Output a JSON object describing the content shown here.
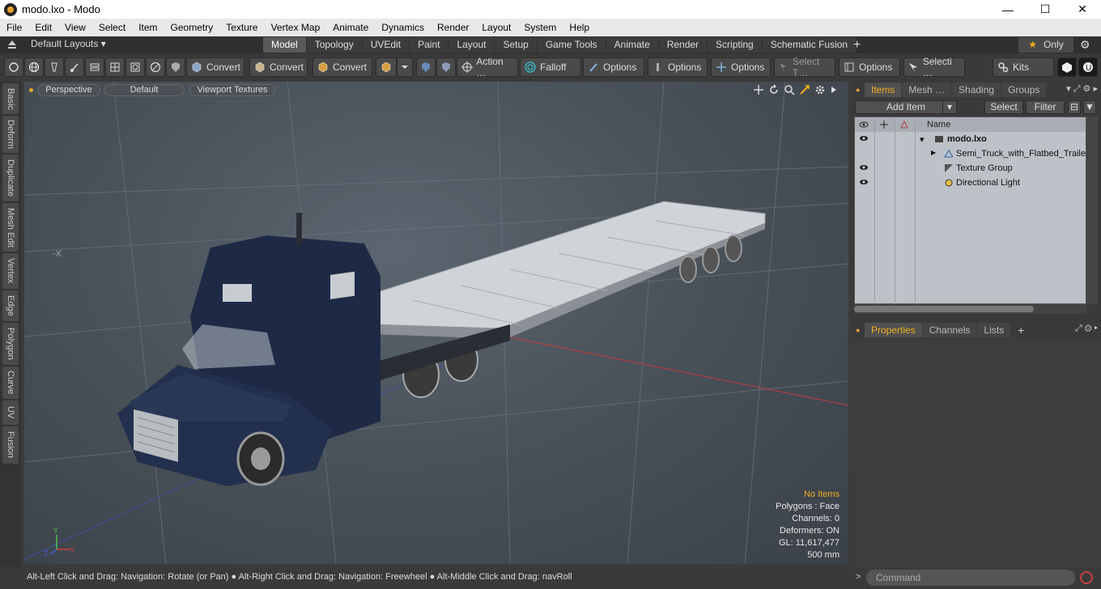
{
  "window": {
    "title": "modo.lxo - Modo",
    "minimize": "—",
    "maximize": "☐",
    "close": "✕"
  },
  "menu": [
    "File",
    "Edit",
    "View",
    "Select",
    "Item",
    "Geometry",
    "Texture",
    "Vertex Map",
    "Animate",
    "Dynamics",
    "Render",
    "Layout",
    "System",
    "Help"
  ],
  "layout": {
    "preset": "Default Layouts ▾",
    "tabs": [
      "Model",
      "Topology",
      "UVEdit",
      "Paint",
      "Layout",
      "Setup",
      "Game Tools",
      "Animate",
      "Render",
      "Scripting",
      "Schematic Fusion"
    ],
    "active_tab": "Model",
    "add": "+",
    "only": "Only",
    "star": "★",
    "gear": "⚙"
  },
  "toolbar": {
    "convert1": "Convert",
    "convert2": "Convert",
    "convert3": "Convert",
    "action": "Action …",
    "falloff": "Falloff",
    "options1": "Options",
    "options2": "Options",
    "options3": "Options",
    "select_t": "Select T…",
    "options4": "Options",
    "selecti": "Selecti …",
    "kits": "Kits"
  },
  "left_tabs": [
    "Basic",
    "Deform",
    "Duplicate",
    "Mesh Edit",
    "Vertex",
    "Edge",
    "Polygon",
    "Curve",
    "UV",
    "Fusion"
  ],
  "viewport": {
    "view": "Perspective",
    "shading": "Default",
    "textures": "Viewport Textures",
    "axis_label": "-X",
    "stats": {
      "no_items": "No Items",
      "polygons": "Polygons : Face",
      "channels": "Channels: 0",
      "deformers": "Deformers: ON",
      "gl": "GL: 11,617,477",
      "scale": "500 mm"
    },
    "gizmo": {
      "y": "Y",
      "x": "X",
      "z": "Z"
    }
  },
  "items_panel": {
    "tabs": [
      "Items",
      "Mesh …",
      "Shading",
      "Groups"
    ],
    "active_tab": "Items",
    "add_item": "Add Item",
    "select": "Select",
    "filter": "Filter",
    "name_header": "Name",
    "rows": [
      {
        "label": "modo.lxo",
        "bold": true
      },
      {
        "label": "Semi_Truck_with_Flatbed_Trailer"
      },
      {
        "label": "Texture Group"
      },
      {
        "label": "Directional Light"
      }
    ]
  },
  "properties_panel": {
    "tabs": [
      "Properties",
      "Channels",
      "Lists"
    ],
    "active_tab": "Properties",
    "add": "+"
  },
  "status": {
    "hint": "Alt-Left Click and Drag: Navigation: Rotate (or Pan) ● Alt-Right Click and Drag: Navigation: Freewheel ● Alt-Middle Click and Drag: navRoll",
    "command_placeholder": "Command",
    "arrow": ">"
  }
}
